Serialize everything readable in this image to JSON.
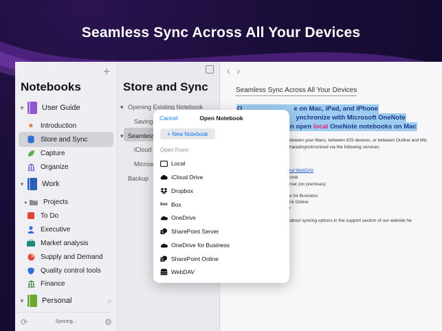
{
  "headline": "Seamless Sync Across All Your Devices",
  "sidebar": {
    "title": "Notebooks",
    "add_label": "+",
    "items": [
      {
        "label": "User Guide",
        "kind": "notebook",
        "color": "#8e58c9"
      },
      {
        "label": "Introduction",
        "icon": "star-icon",
        "color": "#e26a2c"
      },
      {
        "label": "Store and Sync",
        "icon": "database-icon",
        "color": "#2f6fd6",
        "selected": true
      },
      {
        "label": "Capture",
        "icon": "leaf-icon",
        "color": "#5bb04a"
      },
      {
        "label": "Organize",
        "icon": "bank-icon",
        "color": "#6a4bc4"
      },
      {
        "label": "Work",
        "kind": "notebook",
        "color": "#2a5fb8"
      },
      {
        "label": "Projects",
        "icon": "folder-icon",
        "color": "#8d8d93"
      },
      {
        "label": "To Do",
        "icon": "square-icon",
        "color": "#e0433a"
      },
      {
        "label": "Executive",
        "icon": "person-icon",
        "color": "#2f6fd6"
      },
      {
        "label": "Market analysis",
        "icon": "briefcase-icon",
        "color": "#1f8a7a"
      },
      {
        "label": "Supply and Demand",
        "icon": "pie-icon",
        "color": "#e0433a"
      },
      {
        "label": "Quality control tools",
        "icon": "shield-icon",
        "color": "#2f6fd6"
      },
      {
        "label": "Finance",
        "icon": "bank-icon",
        "color": "#3a7d3a"
      },
      {
        "label": "Personal",
        "kind": "notebook",
        "color": "#6aa832"
      }
    ],
    "sync_status": "Syncing..."
  },
  "middle": {
    "title": "Store and Sync",
    "rows": [
      "Opening Existing Notebook",
      "Saving",
      "Seamless",
      "iCloud",
      "Microso",
      "Backup"
    ]
  },
  "page": {
    "title": "Seamless Sync Across All Your Devices",
    "highlight_lines": [
      {
        "a": "O",
        "b": "e on Mac, iPad, and iPhone"
      },
      {
        "a": "S",
        "b": "ynchronize with Microsoft OneNote"
      },
      {
        "a": "",
        "b": "n open ",
        "pink": "local",
        "c": " OneNote notebooks on Mac"
      }
    ],
    "body_lines": [
      "etween your Macs, between iOS devices, or between Outline and Mic",
      "hared/synchronized via the following services:",
      "nd WebDAV",
      "onal",
      "rver (on premises)",
      "e for Business",
      "int Online",
      "r",
      "about syncing options in the support section of our website he"
    ]
  },
  "modal": {
    "cancel": "Cancel",
    "title": "Open Notebook",
    "new_notebook": "+ New Notebook",
    "open_from": "Open From:",
    "locations": [
      {
        "label": "Local",
        "icon": "monitor-icon"
      },
      {
        "label": "iCloud Drive",
        "icon": "cloud-icon"
      },
      {
        "label": "Dropbox",
        "icon": "dropbox-icon"
      },
      {
        "label": "Box",
        "icon": "box-icon"
      },
      {
        "label": "OneDrive",
        "icon": "onedrive-icon"
      },
      {
        "label": "SharePoint Server",
        "icon": "sharepoint-icon"
      },
      {
        "label": "OneDrive for Business",
        "icon": "onedrive-icon"
      },
      {
        "label": "SharePoint Online",
        "icon": "sharepoint-icon"
      },
      {
        "label": "WebDAV",
        "icon": "server-icon"
      }
    ]
  },
  "colors": {
    "accent": "#0a7aff",
    "highlight": "#9ecbf0",
    "pink": "#e0207a"
  }
}
